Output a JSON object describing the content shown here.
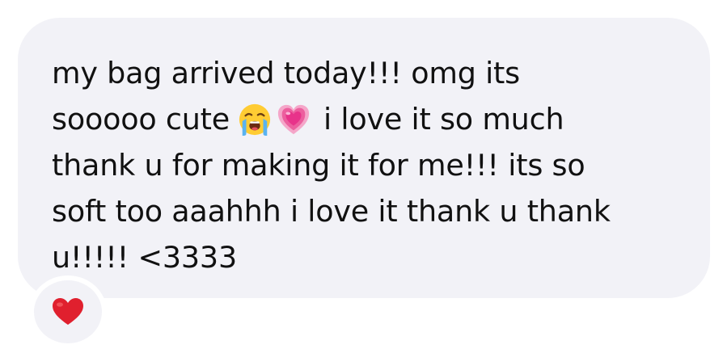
{
  "message": {
    "lines": [
      "my bag arrived today!!! omg its",
      "sooooo cute",
      "i love it so much",
      "thank u for making it for me!!! its so",
      "soft too aaahhh i love it thank u thank",
      "u!!!!! <3333"
    ],
    "emojis": [
      "loudly-crying-face-icon",
      "growing-heart-icon"
    ]
  },
  "reaction": {
    "icon": "red-heart-icon",
    "color": "#e0202e"
  },
  "colors": {
    "bubble": "#f2f2f7",
    "text": "#111111",
    "background": "#ffffff"
  }
}
